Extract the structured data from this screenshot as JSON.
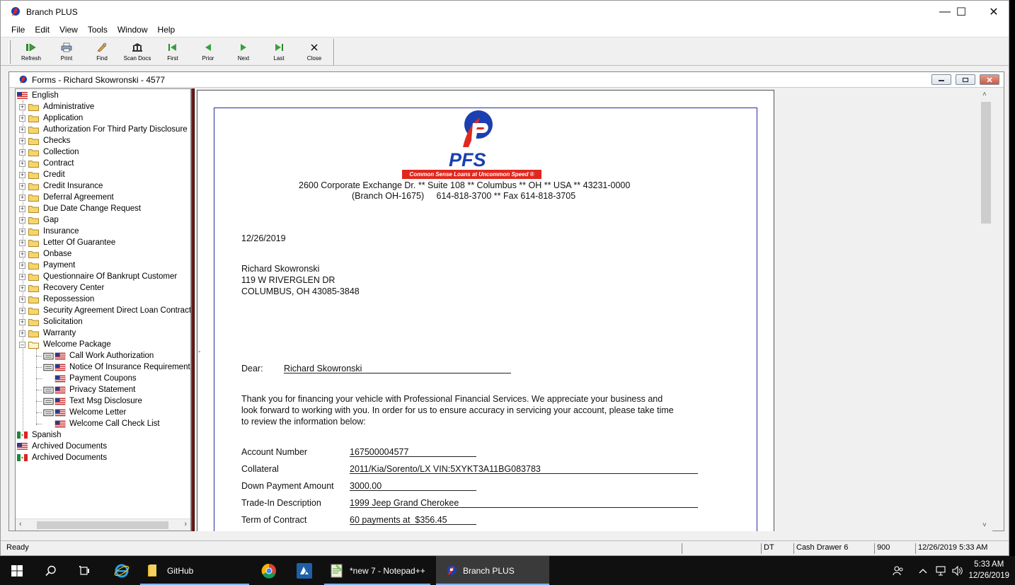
{
  "window": {
    "title": "Branch PLUS",
    "min": "—",
    "max": "☐",
    "close": "✕"
  },
  "menu": [
    "File",
    "Edit",
    "View",
    "Tools",
    "Window",
    "Help"
  ],
  "toolbar": [
    {
      "label": "Refresh",
      "icon": "refresh-icon"
    },
    {
      "label": "Print",
      "icon": "print-icon"
    },
    {
      "label": "Find",
      "icon": "find-icon"
    },
    {
      "label": "Scan Docs",
      "icon": "scan-docs-icon"
    },
    {
      "label": "First",
      "icon": "first-icon"
    },
    {
      "label": "Prior",
      "icon": "prior-icon"
    },
    {
      "label": "Next",
      "icon": "next-icon"
    },
    {
      "label": "Last",
      "icon": "last-icon"
    },
    {
      "label": "Close",
      "icon": "close-icon"
    }
  ],
  "child": {
    "title": "Forms - Richard Skowronski - 4577"
  },
  "tree": {
    "root": "English",
    "folders": [
      "Administrative",
      "Application",
      "Authorization For Third Party Disclosure",
      "Checks",
      "Collection",
      "Contract",
      "Credit",
      "Credit Insurance",
      "Deferral Agreement",
      "Due Date Change Request",
      "Gap",
      "Insurance",
      "Letter Of Guarantee",
      "Onbase",
      "Payment",
      "Questionnaire Of Bankrupt Customer",
      "Recovery Center",
      "Repossession",
      "Security Agreement Direct Loan Contract",
      "Solicitation",
      "Warranty",
      "Welcome Package"
    ],
    "welcome_items": [
      "Call Work Authorization",
      "Notice Of Insurance Requirement",
      "Payment Coupons",
      "Privacy Statement",
      "Text Msg Disclosure",
      "Welcome Letter",
      "Welcome Call Check List"
    ],
    "bottom": [
      "Spanish",
      "Archived Documents",
      "Archived Documents"
    ]
  },
  "letter": {
    "brand": "PFS",
    "tagline": "Common Sense Loans at Uncommon Speed ®",
    "address_line1": "2600 Corporate Exchange Dr. ** Suite 108 ** Columbus ** OH ** USA ** 43231-0000",
    "address_line2": "(Branch OH-1675)     614-818-3700 ** Fax 614-818-3705",
    "date": "12/26/2019",
    "recipient_name": "Richard Skowronski",
    "recipient_street": "119 W RIVERGLEN DR",
    "recipient_city": "COLUMBUS, OH 43085-3848",
    "dear_label": "Dear:",
    "dear_name": "Richard Skowronski",
    "para1": "Thank you for financing your vehicle with Professional Financial Services. We appreciate your business and",
    "para2": "look forward to working with you. In order for us to ensure accuracy in servicing your account, please take time",
    "para3": "to review the information below:",
    "fields": [
      {
        "label": "Account Number",
        "value": "167500004577"
      },
      {
        "label": "Collateral",
        "value": "2011/Kia/Sorento/LX VIN:5XYKT3A11BG083783"
      },
      {
        "label": "Down Payment Amount",
        "value": "3000.00"
      },
      {
        "label": "Trade-In Description",
        "value": "1999 Jeep Grand Cherokee"
      },
      {
        "label": "Term of Contract",
        "value": "60 payments at  $356.45"
      }
    ]
  },
  "status": {
    "ready": "Ready",
    "dt": "DT",
    "drawer": "Cash Drawer 6",
    "num": "900",
    "datetime": "12/26/2019 5:33 AM"
  },
  "taskbar": {
    "github": "GitHub",
    "notepad": "*new 7 - Notepad++",
    "branch": "Branch PLUS",
    "time": "5:33 AM",
    "date": "12/26/2019"
  },
  "colors": {
    "brand_blue": "#1a3fb0",
    "brand_red": "#e0281e",
    "splitter": "#6b1a1a",
    "page_border": "#2a2aa0"
  }
}
